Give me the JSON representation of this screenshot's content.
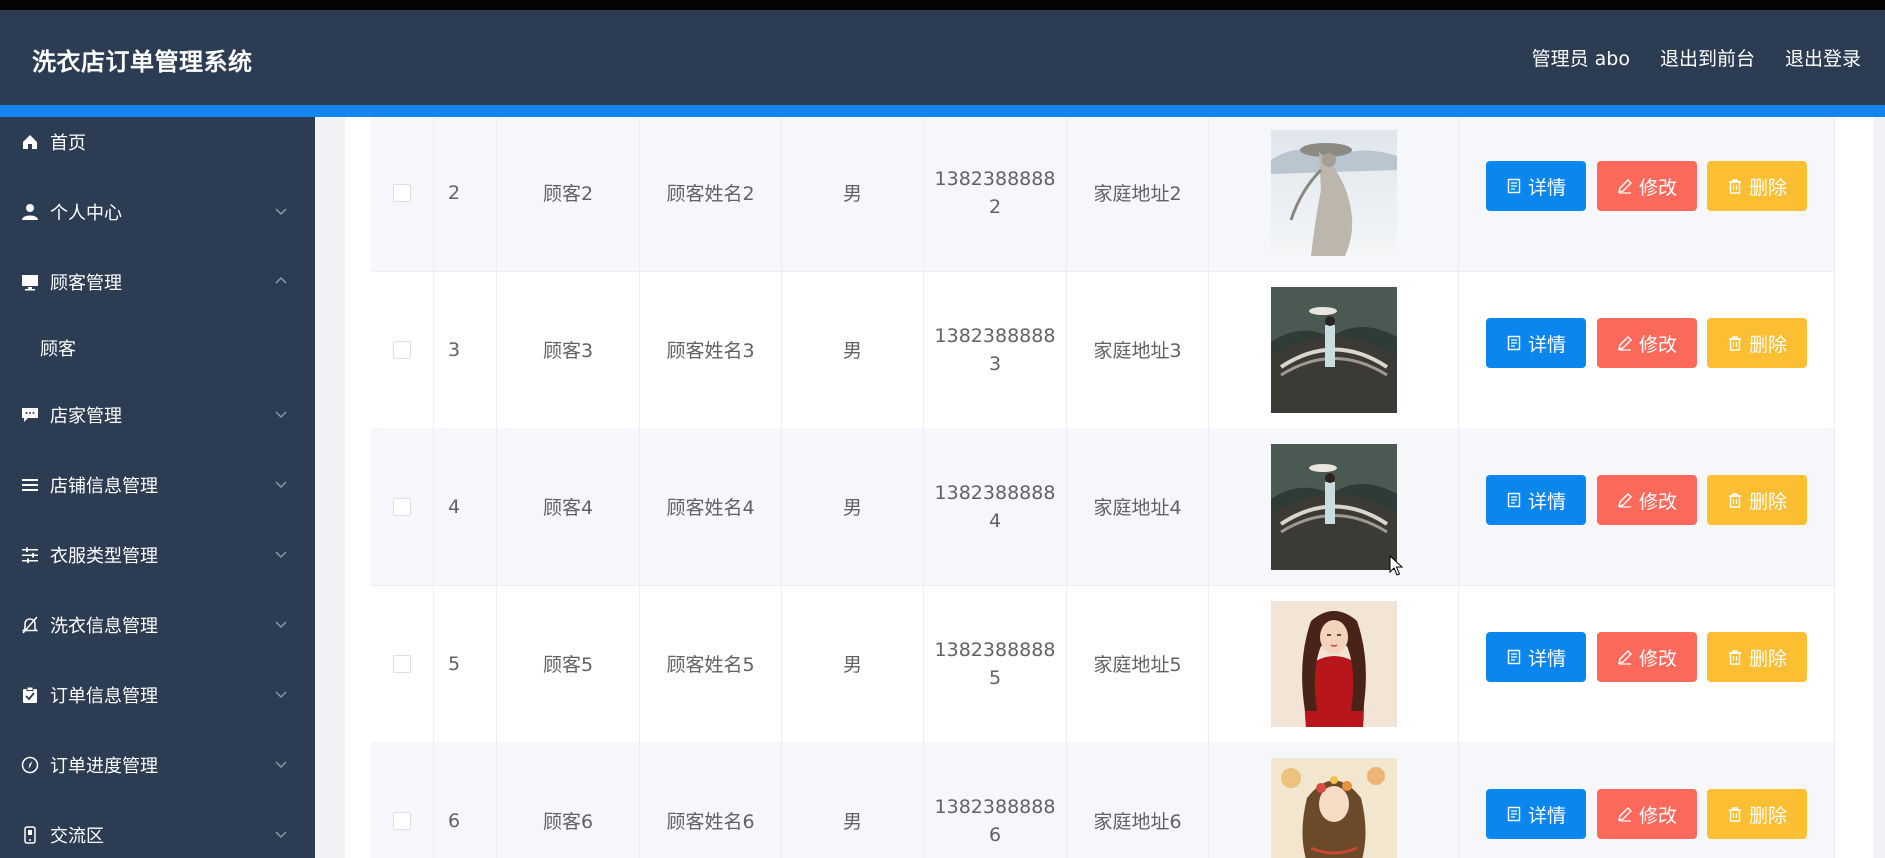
{
  "header": {
    "title": "洗衣店订单管理系统",
    "admin_label": "管理员 abo",
    "to_front_label": "退出到前台",
    "logout_label": "退出登录"
  },
  "sidebar": {
    "items": [
      {
        "label": "首页",
        "icon": "home-icon"
      },
      {
        "label": "个人中心",
        "icon": "user-icon"
      },
      {
        "label": "顾客管理",
        "icon": "monitor-icon",
        "expanded": true
      },
      {
        "label": "店家管理",
        "icon": "chat-icon"
      },
      {
        "label": "店铺信息管理",
        "icon": "list-icon"
      },
      {
        "label": "衣服类型管理",
        "icon": "sliders-icon"
      },
      {
        "label": "洗衣信息管理",
        "icon": "bell-off-icon"
      },
      {
        "label": "订单信息管理",
        "icon": "clipboard-icon"
      },
      {
        "label": "订单进度管理",
        "icon": "compass-icon"
      },
      {
        "label": "交流区",
        "icon": "phone-icon"
      }
    ],
    "submenu": {
      "label": "顾客"
    }
  },
  "table": {
    "buttons": {
      "detail": "详情",
      "edit": "修改",
      "delete": "删除"
    },
    "rows": [
      {
        "index": "2",
        "account": "顾客2",
        "name": "顾客姓名2",
        "gender": "男",
        "phone_line1": "1382388888",
        "phone_line2": "2",
        "address": "家庭地址2",
        "image": "figure-in-mist"
      },
      {
        "index": "3",
        "account": "顾客3",
        "name": "顾客姓名3",
        "gender": "男",
        "phone_line1": "1382388888",
        "phone_line2": "3",
        "address": "家庭地址3",
        "image": "bridge-in-forest"
      },
      {
        "index": "4",
        "account": "顾客4",
        "name": "顾客姓名4",
        "gender": "男",
        "phone_line1": "1382388888",
        "phone_line2": "4",
        "address": "家庭地址4",
        "image": "bridge-in-forest"
      },
      {
        "index": "5",
        "account": "顾客5",
        "name": "顾客姓名5",
        "gender": "男",
        "phone_line1": "1382388888",
        "phone_line2": "5",
        "address": "家庭地址5",
        "image": "woman-in-red"
      },
      {
        "index": "6",
        "account": "顾客6",
        "name": "顾客姓名6",
        "gender": "男",
        "phone_line1": "1382388888",
        "phone_line2": "6",
        "address": "家庭地址6",
        "image": "girl-with-flowers"
      }
    ]
  },
  "colors": {
    "header_bg": "#2b3c53",
    "accent": "#1286ee",
    "detail_button": "#0b86ee",
    "edit_button": "#fd6a5c",
    "delete_button": "#fcbf33"
  }
}
